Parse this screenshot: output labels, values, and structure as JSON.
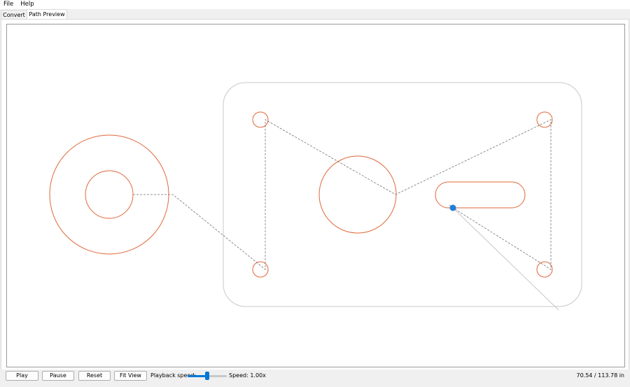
{
  "menu": {
    "file": "File",
    "help": "Help"
  },
  "tabs": {
    "convert": "Convert",
    "preview": "Path Preview"
  },
  "controls": {
    "play": "Play",
    "pause": "Pause",
    "reset": "Reset",
    "fit_view": "Fit View",
    "playback_label": "Playback speed:",
    "playback_fraction": 0.5,
    "speed_text": "Speed: 1.00x",
    "progress_text": "70.54 / 113.78 in"
  },
  "colors": {
    "cut_path": "#e0673a",
    "travel_path": "#707070",
    "outline": "#c8c8c8",
    "tool_marker": "#1f7fd6",
    "accent": "#0078d7"
  }
}
